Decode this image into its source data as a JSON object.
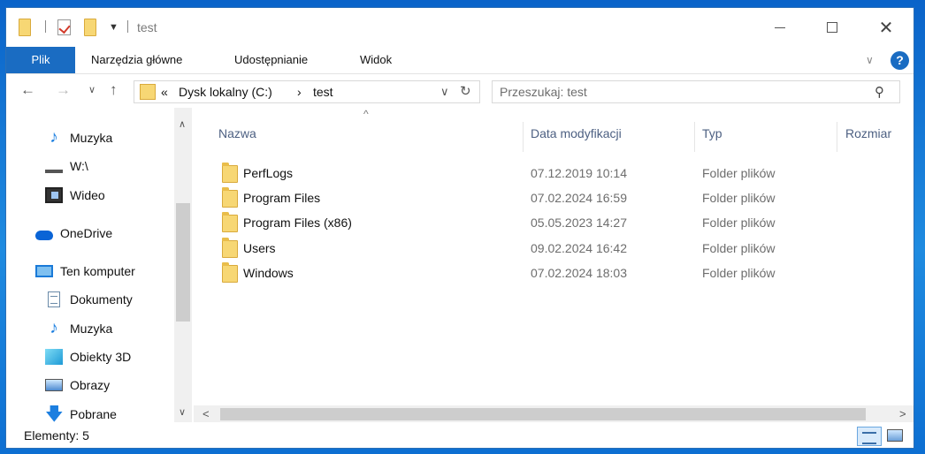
{
  "window": {
    "title": "test"
  },
  "ribbon": {
    "tabs": [
      {
        "label": "Plik",
        "active": true
      },
      {
        "label": "Narzędzia główne"
      },
      {
        "label": "Udostępnianie"
      },
      {
        "label": "Widok"
      }
    ],
    "help_label": "?"
  },
  "address": {
    "overflow_marker": "«",
    "breadcrumbs": [
      "Dysk lokalny (C:)",
      "test"
    ],
    "separator": "›"
  },
  "search": {
    "placeholder": "Przeszukaj: test"
  },
  "nav_pane": {
    "items": [
      {
        "label": "Muzyka",
        "icon": "music-icon"
      },
      {
        "label": "W:\\",
        "icon": "drive-icon"
      },
      {
        "label": "Wideo",
        "icon": "video-icon"
      },
      {
        "label": "OneDrive",
        "icon": "onedrive-icon"
      },
      {
        "label": "Ten komputer",
        "icon": "computer-icon"
      },
      {
        "label": "Dokumenty",
        "icon": "documents-icon"
      },
      {
        "label": "Muzyka",
        "icon": "music-icon"
      },
      {
        "label": "Obiekty 3D",
        "icon": "3d-objects-icon"
      },
      {
        "label": "Obrazy",
        "icon": "pictures-icon"
      },
      {
        "label": "Pobrane",
        "icon": "downloads-icon"
      }
    ]
  },
  "file_list": {
    "columns": [
      "Nazwa",
      "Data modyfikacji",
      "Typ",
      "Rozmiar"
    ],
    "rows": [
      {
        "name": "PerfLogs",
        "date": "07.12.2019 10:14",
        "type": "Folder plików"
      },
      {
        "name": "Program Files",
        "date": "07.02.2024 16:59",
        "type": "Folder plików"
      },
      {
        "name": "Program Files (x86)",
        "date": "05.05.2023 14:27",
        "type": "Folder plików"
      },
      {
        "name": "Users",
        "date": "09.02.2024 16:42",
        "type": "Folder plików"
      },
      {
        "name": "Windows",
        "date": "07.02.2024 18:03",
        "type": "Folder plików"
      }
    ]
  },
  "status_bar": {
    "item_count": "Elementy: 5"
  },
  "colors": {
    "accent": "#1a6cc2",
    "folder": "#f7d774",
    "header_text": "#4d6082"
  }
}
